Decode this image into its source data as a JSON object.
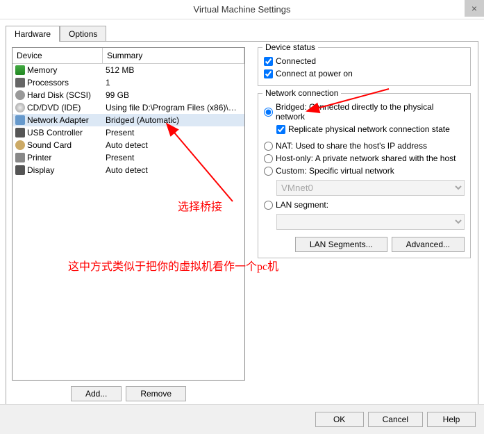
{
  "title": "Virtual Machine Settings",
  "tabs": {
    "hardware": "Hardware",
    "options": "Options"
  },
  "table": {
    "col1": "Device",
    "col2": "Summary",
    "rows": [
      {
        "icon": "mem",
        "name": "Memory",
        "summary": "512 MB"
      },
      {
        "icon": "cpu",
        "name": "Processors",
        "summary": "1"
      },
      {
        "icon": "hdd",
        "name": "Hard Disk (SCSI)",
        "summary": "99 GB"
      },
      {
        "icon": "cd",
        "name": "CD/DVD (IDE)",
        "summary": "Using file D:\\Program Files (x86)\\Virtua..."
      },
      {
        "icon": "net",
        "name": "Network Adapter",
        "summary": "Bridged (Automatic)",
        "selected": true
      },
      {
        "icon": "usb",
        "name": "USB Controller",
        "summary": "Present"
      },
      {
        "icon": "snd",
        "name": "Sound Card",
        "summary": "Auto detect"
      },
      {
        "icon": "prn",
        "name": "Printer",
        "summary": "Present"
      },
      {
        "icon": "dsp",
        "name": "Display",
        "summary": "Auto detect"
      }
    ]
  },
  "buttons": {
    "add": "Add...",
    "remove": "Remove"
  },
  "deviceStatus": {
    "title": "Device status",
    "connected": "Connected",
    "connectedChecked": true,
    "poweron": "Connect at power on",
    "poweronChecked": true
  },
  "netconn": {
    "title": "Network connection",
    "bridged": "Bridged: Connected directly to the physical network",
    "replicate": "Replicate physical network connection state",
    "replicateChecked": true,
    "nat": "NAT: Used to share the host's IP address",
    "hostonly": "Host-only: A private network shared with the host",
    "custom": "Custom: Specific virtual network",
    "customSel": "VMnet0",
    "lanseg": "LAN segment:",
    "selected": "bridged",
    "lanbtn": "LAN Segments...",
    "advbtn": "Advanced..."
  },
  "footer": {
    "ok": "OK",
    "cancel": "Cancel",
    "help": "Help"
  },
  "annotations": {
    "a1": "选择桥接",
    "a2": "这中方式类似于把你的虚拟机看作一个pc机"
  }
}
